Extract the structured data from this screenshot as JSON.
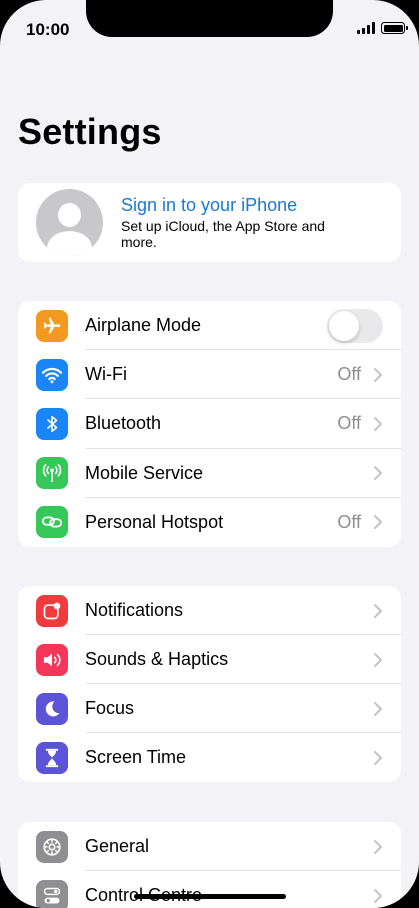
{
  "status_bar": {
    "time": "10:00"
  },
  "page": {
    "title": "Settings"
  },
  "profile": {
    "title": "Sign in to your iPhone",
    "subtitle": "Set up iCloud, the App Store and more."
  },
  "colors": {
    "orange": "#f39a1e",
    "blue": "#1a85f7",
    "green": "#36c759",
    "red": "#f03a3d",
    "pink": "#f2375a",
    "indigo": "#5b54d6",
    "gray": "#8e8e93",
    "link": "#1a78d6"
  },
  "group1": [
    {
      "label": "Airplane Mode",
      "icon": "airplane-icon",
      "control": "toggle",
      "toggle_on": false
    },
    {
      "label": "Wi-Fi",
      "icon": "wifi-icon",
      "value": "Off"
    },
    {
      "label": "Bluetooth",
      "icon": "bluetooth-icon",
      "value": "Off"
    },
    {
      "label": "Mobile Service",
      "icon": "antenna-icon",
      "value": ""
    },
    {
      "label": "Personal Hotspot",
      "icon": "hotspot-link-icon",
      "value": "Off"
    }
  ],
  "group2": [
    {
      "label": "Notifications",
      "icon": "notification-bell-icon"
    },
    {
      "label": "Sounds & Haptics",
      "icon": "speaker-icon"
    },
    {
      "label": "Focus",
      "icon": "moon-icon"
    },
    {
      "label": "Screen Time",
      "icon": "hourglass-icon"
    }
  ],
  "group3": [
    {
      "label": "General",
      "icon": "gear-icon"
    },
    {
      "label": "Control Centre",
      "icon": "toggles-icon"
    }
  ]
}
